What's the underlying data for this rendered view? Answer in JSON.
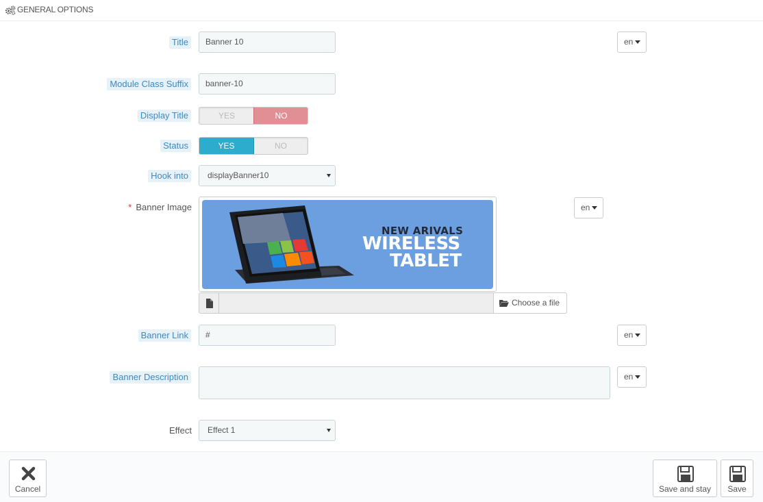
{
  "header": {
    "title": "GENERAL OPTIONS",
    "icon": "gears-icon"
  },
  "fields": {
    "title": {
      "label": "Title",
      "value": "Banner 10",
      "lang": "en"
    },
    "class_suffix": {
      "label": "Module Class Suffix",
      "value": "banner-10"
    },
    "display_title": {
      "label": "Display Title",
      "yes": "YES",
      "no": "NO",
      "selected": "NO"
    },
    "status": {
      "label": "Status",
      "yes": "YES",
      "no": "NO",
      "selected": "YES"
    },
    "hook_into": {
      "label": "Hook into",
      "value": "displayBanner10"
    },
    "banner_image": {
      "required_mark": "*",
      "label": "Banner Image",
      "lang": "en",
      "image_text": {
        "line1": "NEW ARIVALS",
        "line2": "WIRELESS",
        "line3": "TABLET"
      },
      "choose_file": "Choose a file"
    },
    "banner_link": {
      "label": "Banner Link",
      "value": "#",
      "lang": "en"
    },
    "banner_description": {
      "label": "Banner Description",
      "value": "",
      "lang": "en"
    },
    "effect": {
      "label": "Effect",
      "value": "Effect 1"
    }
  },
  "footer": {
    "cancel": "Cancel",
    "save_and_stay": "Save and stay",
    "save": "Save"
  },
  "colors": {
    "hint_bg": "#e7f1f8",
    "hint_text": "#3e8ac2",
    "switch_no_active": "#e08f95",
    "switch_yes_active": "#2eacce",
    "banner_bg": "#6b9fdf"
  }
}
